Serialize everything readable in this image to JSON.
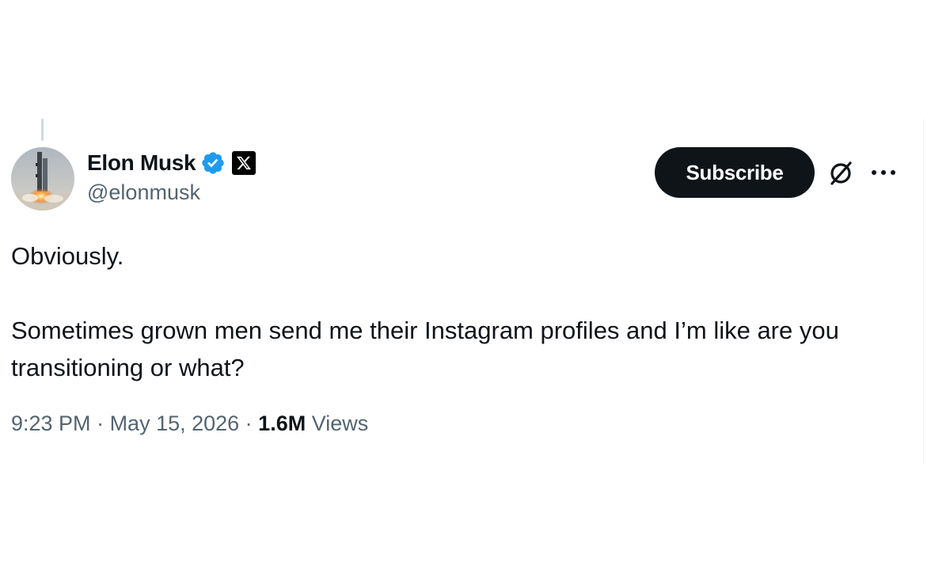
{
  "author": {
    "display_name": "Elon Musk",
    "handle": "@elonmusk",
    "avatar_icon": "rocket-launch-avatar",
    "verified_icon": "verified-badge-icon",
    "verified_color": "#1d9bf0",
    "affiliate_icon": "x-logo-icon"
  },
  "actions": {
    "subscribe_label": "Subscribe",
    "grok_icon": "grok-icon",
    "more_icon": "more-icon"
  },
  "tweet": {
    "paragraphs": [
      "Obviously.",
      "Sometimes grown men send me their Instagram profiles and I’m like are you transitioning or what?"
    ]
  },
  "meta": {
    "time": "9:23 PM",
    "separator": " · ",
    "date": "May 15, 2026",
    "views_count": "1.6M",
    "views_label": "Views"
  },
  "colors": {
    "text_primary": "#0f1419",
    "text_secondary": "#536471",
    "button_bg": "#0f1419"
  }
}
